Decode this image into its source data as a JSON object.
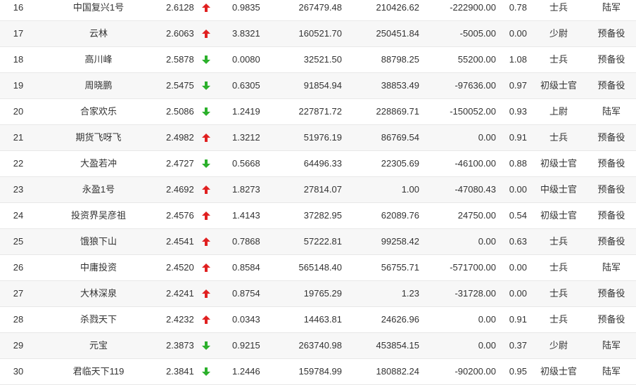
{
  "colors": {
    "up": "#e02020",
    "down": "#2bb02b",
    "row_alt": "#f7f7f7",
    "text": "#333333"
  },
  "rows": [
    {
      "rank": "16",
      "name": "中国复兴1号",
      "value": "2.6128",
      "trend": "up",
      "v2": "0.9835",
      "v3": "267479.48",
      "v4": "210426.62",
      "v5": "-222900.00",
      "v6": "0.78",
      "rank_title": "士兵",
      "branch": "陆军"
    },
    {
      "rank": "17",
      "name": "云林",
      "value": "2.6063",
      "trend": "up",
      "v2": "3.8321",
      "v3": "160521.70",
      "v4": "250451.84",
      "v5": "-5005.00",
      "v6": "0.00",
      "rank_title": "少尉",
      "branch": "预备役"
    },
    {
      "rank": "18",
      "name": "高川峰",
      "value": "2.5878",
      "trend": "down",
      "v2": "0.0080",
      "v3": "32521.50",
      "v4": "88798.25",
      "v5": "55200.00",
      "v6": "1.08",
      "rank_title": "士兵",
      "branch": "预备役"
    },
    {
      "rank": "19",
      "name": "周晓鹏",
      "value": "2.5475",
      "trend": "down",
      "v2": "0.6305",
      "v3": "91854.94",
      "v4": "38853.49",
      "v5": "-97636.00",
      "v6": "0.97",
      "rank_title": "初级士官",
      "branch": "预备役"
    },
    {
      "rank": "20",
      "name": "合家欢乐",
      "value": "2.5086",
      "trend": "down",
      "v2": "1.2419",
      "v3": "227871.72",
      "v4": "228869.71",
      "v5": "-150052.00",
      "v6": "0.93",
      "rank_title": "上尉",
      "branch": "陆军"
    },
    {
      "rank": "21",
      "name": "期货飞呀飞",
      "value": "2.4982",
      "trend": "up",
      "v2": "1.3212",
      "v3": "51976.19",
      "v4": "86769.54",
      "v5": "0.00",
      "v6": "0.91",
      "rank_title": "士兵",
      "branch": "预备役"
    },
    {
      "rank": "22",
      "name": "大盈若冲",
      "value": "2.4727",
      "trend": "down",
      "v2": "0.5668",
      "v3": "64496.33",
      "v4": "22305.69",
      "v5": "-46100.00",
      "v6": "0.88",
      "rank_title": "初级士官",
      "branch": "预备役"
    },
    {
      "rank": "23",
      "name": "永盈1号",
      "value": "2.4692",
      "trend": "up",
      "v2": "1.8273",
      "v3": "27814.07",
      "v4": "1.00",
      "v5": "-47080.43",
      "v6": "0.00",
      "rank_title": "中级士官",
      "branch": "预备役"
    },
    {
      "rank": "24",
      "name": "投资界吴彦祖",
      "value": "2.4576",
      "trend": "up",
      "v2": "1.4143",
      "v3": "37282.95",
      "v4": "62089.76",
      "v5": "24750.00",
      "v6": "0.54",
      "rank_title": "初级士官",
      "branch": "预备役"
    },
    {
      "rank": "25",
      "name": "饿狼下山",
      "value": "2.4541",
      "trend": "up",
      "v2": "0.7868",
      "v3": "57222.81",
      "v4": "99258.42",
      "v5": "0.00",
      "v6": "0.63",
      "rank_title": "士兵",
      "branch": "预备役"
    },
    {
      "rank": "26",
      "name": "中庸投资",
      "value": "2.4520",
      "trend": "up",
      "v2": "0.8584",
      "v3": "565148.40",
      "v4": "56755.71",
      "v5": "-571700.00",
      "v6": "0.00",
      "rank_title": "士兵",
      "branch": "陆军"
    },
    {
      "rank": "27",
      "name": "大林深泉",
      "value": "2.4241",
      "trend": "up",
      "v2": "0.8754",
      "v3": "19765.29",
      "v4": "1.23",
      "v5": "-31728.00",
      "v6": "0.00",
      "rank_title": "士兵",
      "branch": "预备役"
    },
    {
      "rank": "28",
      "name": "杀戮天下",
      "value": "2.4232",
      "trend": "up",
      "v2": "0.0343",
      "v3": "14463.81",
      "v4": "24626.96",
      "v5": "0.00",
      "v6": "0.91",
      "rank_title": "士兵",
      "branch": "预备役"
    },
    {
      "rank": "29",
      "name": "元宝",
      "value": "2.3873",
      "trend": "down",
      "v2": "0.9215",
      "v3": "263740.98",
      "v4": "453854.15",
      "v5": "0.00",
      "v6": "0.37",
      "rank_title": "少尉",
      "branch": "陆军"
    },
    {
      "rank": "30",
      "name": "君临天下119",
      "value": "2.3841",
      "trend": "down",
      "v2": "1.2446",
      "v3": "159784.99",
      "v4": "180882.24",
      "v5": "-90200.00",
      "v6": "0.95",
      "rank_title": "初级士官",
      "branch": "陆军"
    }
  ]
}
